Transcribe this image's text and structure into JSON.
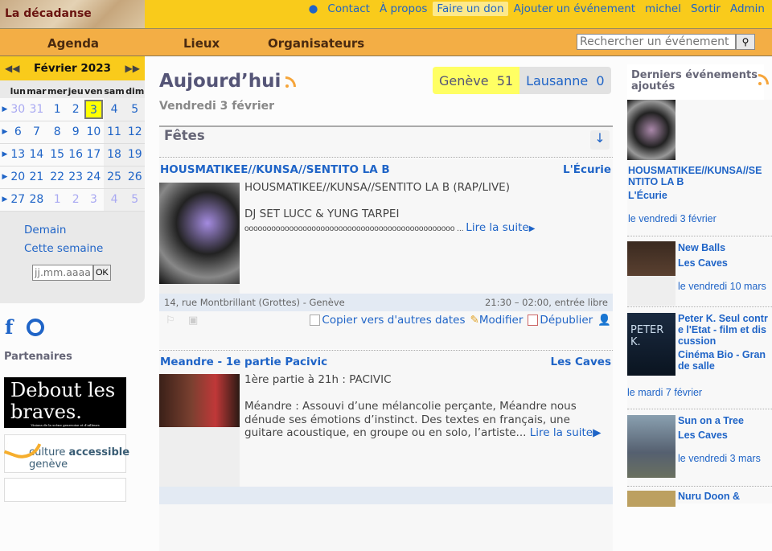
{
  "site": {
    "logo": "La décadanse"
  },
  "topnav": {
    "github_icon": "github-icon",
    "items": [
      "Contact",
      "À propos",
      "Faire un don",
      "Ajouter un événement",
      "michel",
      "Sortir",
      "Admin"
    ]
  },
  "nav": {
    "items": [
      "Agenda",
      "Lieux",
      "Organisateurs"
    ],
    "search_placeholder": "Rechercher un événement",
    "search_icon": "magnifier-icon"
  },
  "calendar": {
    "month": "Février 2023",
    "prev": "◀◀",
    "next": "▶▶",
    "days": [
      "lun",
      "mar",
      "mer",
      "jeu",
      "ven",
      "sam",
      "dim"
    ],
    "weeks": [
      [
        "30",
        "31",
        "1",
        "2",
        "3",
        "4",
        "5"
      ],
      [
        "6",
        "7",
        "8",
        "9",
        "10",
        "11",
        "12"
      ],
      [
        "13",
        "14",
        "15",
        "16",
        "17",
        "18",
        "19"
      ],
      [
        "20",
        "21",
        "22",
        "23",
        "24",
        "25",
        "26"
      ],
      [
        "27",
        "28",
        "1",
        "2",
        "3",
        "4",
        "5"
      ]
    ],
    "today": "3"
  },
  "quick": {
    "tomorrow": "Demain",
    "week": "Cette semaine",
    "date_placeholder": "jj.mm.aaaa",
    "ok": "OK"
  },
  "partners": {
    "title": "Partenaires",
    "logo1": "Debout les braves.",
    "logo1_small": "Visions de la scène genevoise et d'ailleurs",
    "logo2a": "culture",
    "logo2b": "accessible",
    "logo2c": "genève"
  },
  "main": {
    "title": "Aujourd’hui",
    "date": "Vendredi 3 février",
    "regions": [
      {
        "name": "Genève",
        "count": "51"
      },
      {
        "name": "Lausanne",
        "count": "0"
      }
    ],
    "category": "Fêtes",
    "down": "↓",
    "events": [
      {
        "title": "HOUSMATIKEE//KUNSA//SENTITO LA B",
        "place": "L'Écurie",
        "desc1": "HOUSMATIKEE//KUNSA//SENTITO LA B (RAP/LIVE)",
        "desc2": "DJ SET LUCC & YUNG TARPEI",
        "desc3": "ooooooooooooooooooooooooooooooooooooooooooooooo ...",
        "more": "Lire la suite",
        "address": "14, rue Montbrillant (Grottes) - Genève",
        "time": "21:30 – 02:00, entrée libre",
        "actions": [
          "Copier vers d'autres dates",
          "Modifier",
          "Dépublier"
        ]
      },
      {
        "title": "Meandre - 1e partie Pacivic",
        "place": "Les Caves",
        "desc1": "1ère partie à 21h : PACIVIC",
        "desc2": "Méandre : Assouvi d’une mélancolie perçante, Méandre nous dénude ses émotions d’instinct. Des textes en français, une guitare acoustique, en groupe ou en solo, l’artiste...",
        "more": "Lire la suite"
      }
    ]
  },
  "sidebar_right": {
    "title": "Derniers événements ajoutés",
    "items": [
      {
        "title": "HOUSMATIKEE//KUNSA//SENTITO LA B",
        "place": "L'Écurie",
        "date": "le vendredi 3 février"
      },
      {
        "title": "New Balls",
        "place": "Les Caves",
        "date": "le vendredi 10 mars"
      },
      {
        "title": "Peter K. Seul contre l'Etat - film et discussion",
        "place": "Cinéma Bio - Grande salle",
        "date": "le mardi 7 février"
      },
      {
        "title": "Sun on a Tree",
        "place": "Les Caves",
        "date": "le vendredi 3 mars"
      },
      {
        "title": "Nuru Doon &",
        "place": "",
        "date": ""
      }
    ]
  },
  "colors": {
    "header": "#f9cb1b",
    "nav": "#f3ae45",
    "link": "#1f64c7",
    "today": "#ffff00"
  }
}
